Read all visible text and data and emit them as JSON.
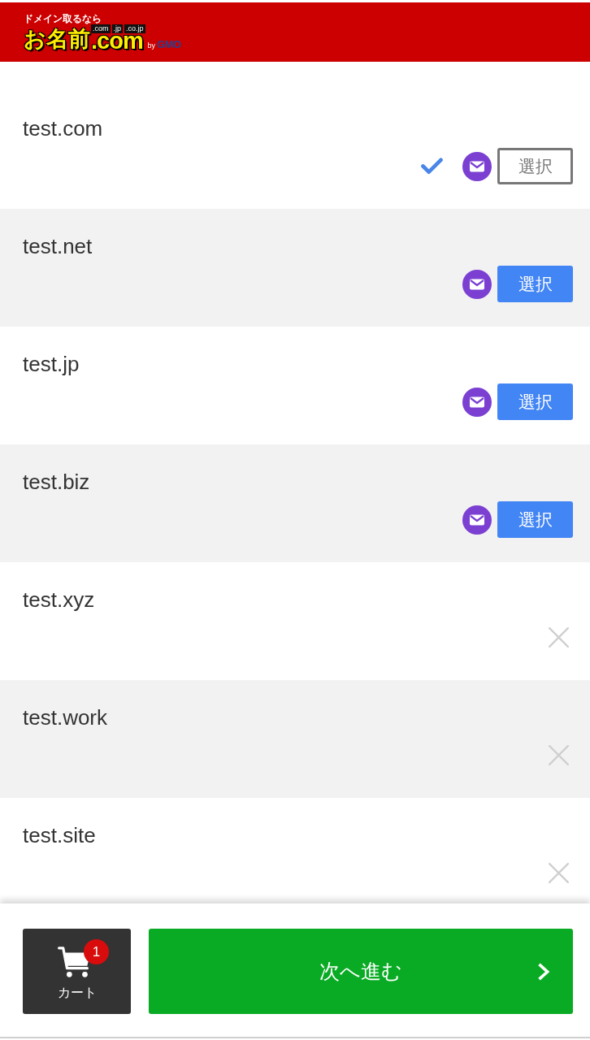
{
  "header": {
    "logo": {
      "tagline": "ドメイン取るなら",
      "name": "お名前",
      "domain": ".com",
      "tlds": [
        ".com",
        ".jp",
        ".co.jp"
      ],
      "by": "by",
      "brand": "GMO"
    }
  },
  "domains": [
    {
      "name": "test.com",
      "kind": "available",
      "selected": true,
      "button": "選択"
    },
    {
      "name": "test.net",
      "kind": "available",
      "selected": false,
      "button": "選択"
    },
    {
      "name": "test.jp",
      "kind": "available",
      "selected": false,
      "button": "選択"
    },
    {
      "name": "test.biz",
      "kind": "available",
      "selected": false,
      "button": "選択"
    },
    {
      "name": "test.xyz",
      "kind": "unavailable",
      "selected": false
    },
    {
      "name": "test.work",
      "kind": "unavailable",
      "selected": false
    },
    {
      "name": "test.site",
      "kind": "unavailable",
      "selected": false
    }
  ],
  "footer": {
    "cart": {
      "label": "カート",
      "count": "1"
    },
    "next_button": {
      "label": "次へ進む"
    }
  }
}
